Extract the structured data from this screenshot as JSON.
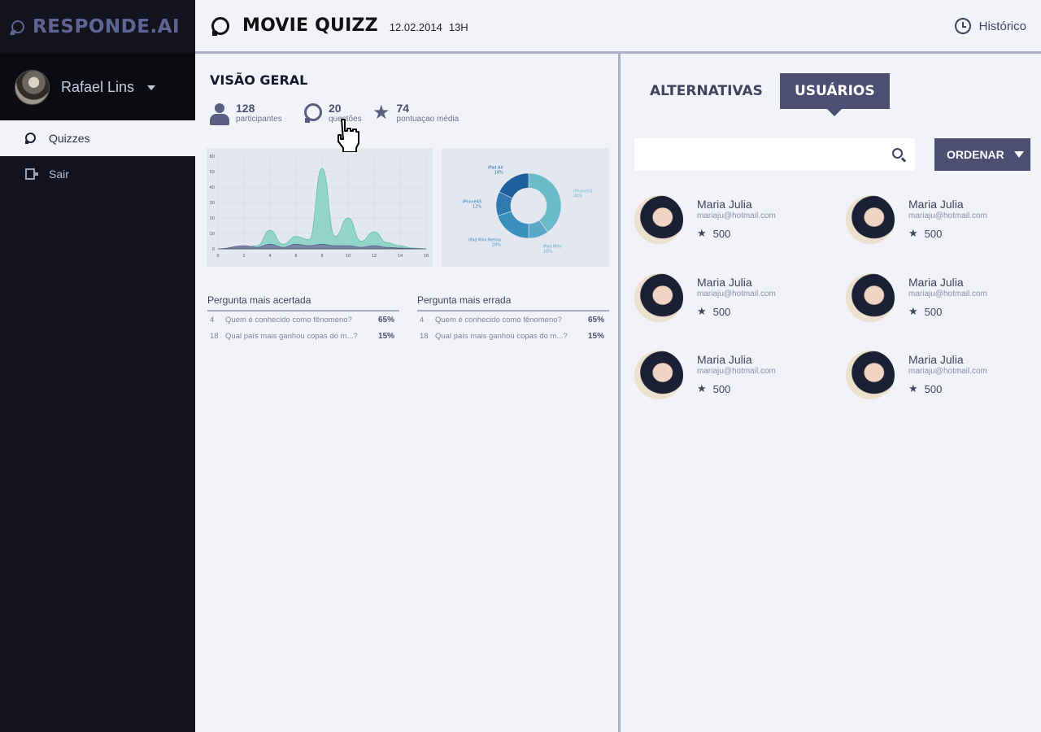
{
  "brand": {
    "name": "RESPONDE.AI"
  },
  "user": {
    "name": "Rafael Lins"
  },
  "nav": [
    {
      "label": "Quizzes",
      "icon": "bubble-icon",
      "active": true
    },
    {
      "label": "Sair",
      "icon": "exit-icon",
      "active": false
    }
  ],
  "header": {
    "title": "MOVIE QUIZZ",
    "date": "12.02.2014",
    "time": "13H",
    "history_label": "Histórico"
  },
  "overview": {
    "title": "VISÃO GERAL",
    "stats": [
      {
        "value": "128",
        "label": "participantes",
        "icon": "person-icon"
      },
      {
        "value": "20",
        "label": "questões",
        "icon": "bubble-icon"
      },
      {
        "value": "74",
        "label": "pontuaçao média",
        "icon": "star-icon"
      }
    ]
  },
  "chart_data": [
    {
      "type": "area",
      "x_ticks": [
        "0",
        "2",
        "4",
        "6",
        "8",
        "10",
        "12",
        "14",
        "16"
      ],
      "y_ticks": [
        "0",
        "10",
        "20",
        "30",
        "40",
        "50",
        "60"
      ],
      "xlim": [
        0,
        16
      ],
      "ylim": [
        0,
        60
      ],
      "grid": true,
      "series": [
        {
          "x": [
            0,
            2,
            3,
            4,
            5,
            6,
            7,
            8,
            9,
            10,
            11,
            12,
            13,
            14,
            15,
            16
          ],
          "values": [
            0,
            1,
            2,
            12,
            3,
            8,
            6,
            52,
            8,
            20,
            5,
            11,
            4,
            2,
            0.5,
            0
          ],
          "color": "#7fd1c0"
        },
        {
          "x": [
            0,
            2,
            3,
            4,
            5,
            6,
            7,
            8,
            9,
            10,
            11,
            12,
            13,
            14,
            15,
            16
          ],
          "values": [
            0,
            2,
            1,
            3,
            1,
            3,
            2,
            3,
            2,
            2,
            1,
            2,
            1,
            0.5,
            0.2,
            0
          ],
          "color": "#6f6d9a"
        }
      ]
    },
    {
      "type": "pie",
      "categories": [
        "iPhone5S",
        "iPad Mini",
        "iPad Mini Retina",
        "iPhone4S",
        "iPad Air"
      ],
      "labels": [
        "40%",
        "10%",
        "20%",
        "12%",
        "18%"
      ],
      "values": [
        40,
        10,
        20,
        12,
        18
      ],
      "colors": [
        "#6bbac8",
        "#5aa8c7",
        "#3b8fbd",
        "#2f78b0",
        "#1e5f9e"
      ]
    }
  ],
  "tables": [
    {
      "title": "Pergunta mais acertada",
      "rows": [
        {
          "n": "4",
          "q": "Quem é conhecido como fênomeno?",
          "p": "65%"
        },
        {
          "n": "18",
          "q": "Qual país mais ganhou copas do m...?",
          "p": "15%"
        }
      ]
    },
    {
      "title": "Pergunta mais errada",
      "rows": [
        {
          "n": "4",
          "q": "Quem é conhecido como fênomeno?",
          "p": "65%"
        },
        {
          "n": "18",
          "q": "Qual país mais ganhou copas do m...?",
          "p": "15%"
        }
      ]
    }
  ],
  "tabs": [
    {
      "label": "ALTERNATIVAS",
      "active": false
    },
    {
      "label": "USUÁRIOS",
      "active": true
    }
  ],
  "search": {
    "value": ""
  },
  "order_label": "ORDENAR",
  "users": [
    {
      "name": "Maria Julia",
      "email": "mariaju@hotmail.com",
      "score": "500"
    },
    {
      "name": "Maria Julia",
      "email": "mariaju@hotmail.com",
      "score": "500"
    },
    {
      "name": "Maria Julia",
      "email": "mariaju@hotmail.com",
      "score": "500"
    },
    {
      "name": "Maria Julia",
      "email": "mariaju@hotmail.com",
      "score": "500"
    },
    {
      "name": "Maria Julia",
      "email": "mariaju@hotmail.com",
      "score": "500"
    },
    {
      "name": "Maria Julia",
      "email": "mariaju@hotmail.com",
      "score": "500"
    }
  ]
}
